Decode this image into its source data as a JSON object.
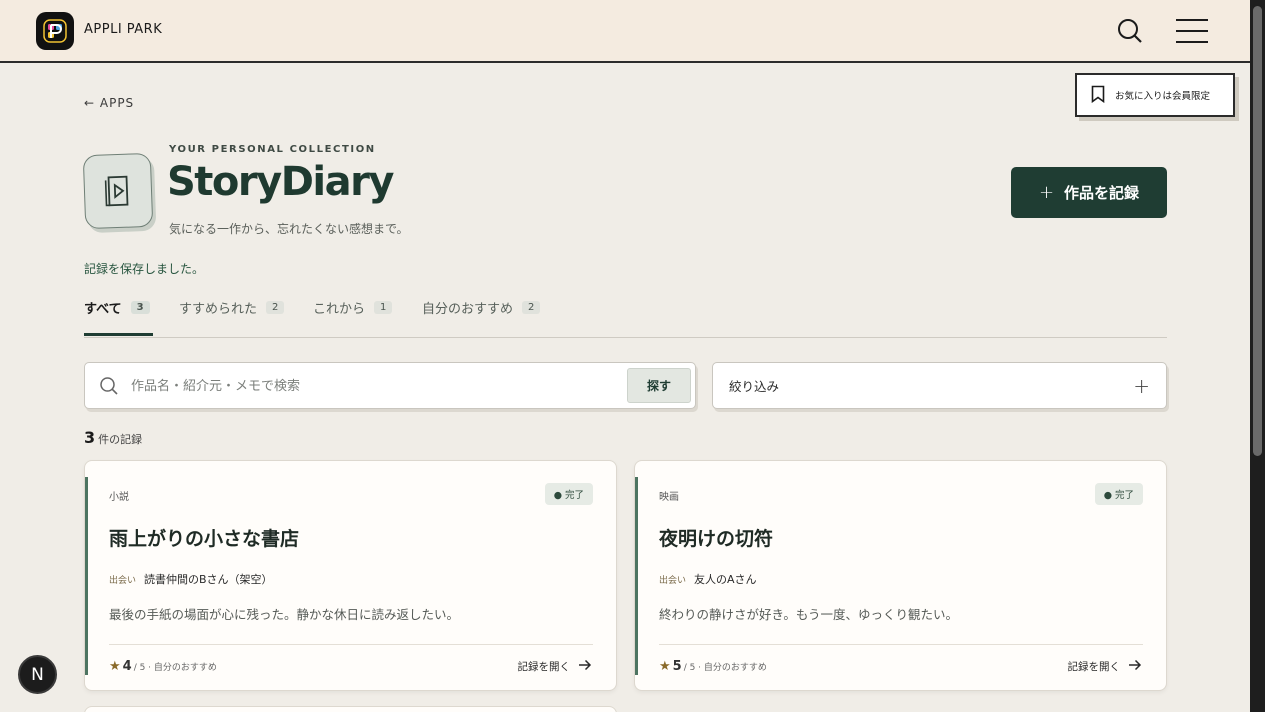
{
  "header": {
    "brand": "APPLI PARK"
  },
  "favorite_badge": "お気に入りは会員限定",
  "back_link": "← APPS",
  "hero": {
    "eyebrow": "YOUR PERSONAL COLLECTION",
    "title": "StoryDiary",
    "subtitle": "気になる一作から、忘れたくない感想まで。",
    "record_button": "作品を記録"
  },
  "saved_message": "記録を保存しました。",
  "tabs": [
    {
      "label": "すべて",
      "count": "3"
    },
    {
      "label": "すすめられた",
      "count": "2"
    },
    {
      "label": "これから",
      "count": "1"
    },
    {
      "label": "自分のおすすめ",
      "count": "2"
    }
  ],
  "search": {
    "placeholder": "作品名・紹介元・メモで検索",
    "value": "",
    "submit": "探す"
  },
  "filter_label": "絞り込み",
  "results": {
    "count": "3",
    "suffix": "件の記録"
  },
  "cards": [
    {
      "genre": "小説",
      "status": "● 完了",
      "title": "雨上がりの小さな書店",
      "meet_label": "出会い",
      "meet": "読書仲間のBさん（架空）",
      "memo": "最後の手紙の場面が心に残った。静かな休日に読み返したい。",
      "rating": "4",
      "rating_suffix": "/ 5 · 自分のおすすめ",
      "open": "記録を開く"
    },
    {
      "genre": "映画",
      "status": "● 完了",
      "title": "夜明けの切符",
      "meet_label": "出会い",
      "meet": "友人のAさん",
      "memo": "終わりの静けさが好き。もう一度、ゆっくり観たい。",
      "rating": "5",
      "rating_suffix": "/ 5 · 自分のおすすめ",
      "open": "記録を開く"
    }
  ],
  "dev_badge": "N",
  "colors": {
    "accent": "#1f3d33",
    "background": "#f0ede7",
    "header_bg": "#f4ebe0",
    "card_bar": "#4d7461"
  },
  "icons": [
    "app-logo-icon",
    "search-icon",
    "hamburger-menu-icon",
    "bookmark-icon",
    "story-app-icon",
    "plus-icon",
    "search-field-icon",
    "star-icon",
    "arrow-right-icon"
  ]
}
